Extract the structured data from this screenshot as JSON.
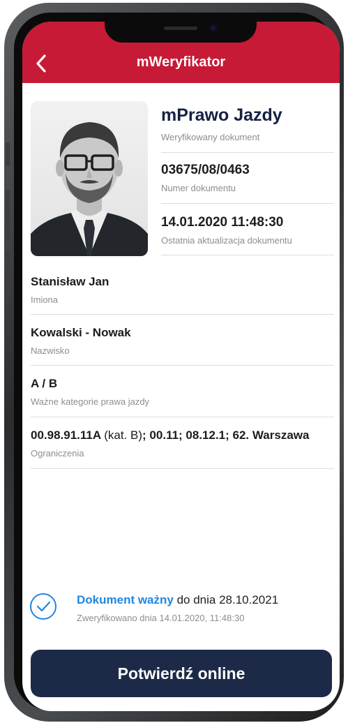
{
  "app": {
    "title": "mWeryfikator"
  },
  "document": {
    "type": "mPrawo Jazdy",
    "type_label": "Weryfikowany dokument",
    "number": "03675/08/0463",
    "number_label": "Numer dokumentu",
    "updated": "14.01.2020 11:48:30",
    "updated_label": "Ostatnia aktualizacja dokumentu"
  },
  "fields": {
    "first_names": {
      "value": "Stanisław Jan",
      "label": "Imiona"
    },
    "surname": {
      "value": "Kowalski - Nowak",
      "label": "Nazwisko"
    },
    "categories": {
      "value": "A / B",
      "label": "Ważne kategorie prawa jazdy"
    },
    "restrictions": {
      "code1": "00.98.91.11A",
      "note": "(kat. B)",
      "rest": "; 00.11; 08.12.1; 62. Warszawa",
      "label": "Ograniczenia"
    }
  },
  "validity": {
    "status": "Dokument ważny",
    "until": "do dnia 28.10.2021",
    "verified": "Zweryfikowano dnia 14.01.2020, 11:48:30"
  },
  "actions": {
    "confirm_label": "Potwierdź online"
  },
  "icons": {
    "back": "chevron-left-icon",
    "check": "check-circle-icon"
  },
  "colors": {
    "header": "#c71a36",
    "accent": "#1f86e0",
    "button": "#1c2a47",
    "doc_title": "#152142"
  }
}
